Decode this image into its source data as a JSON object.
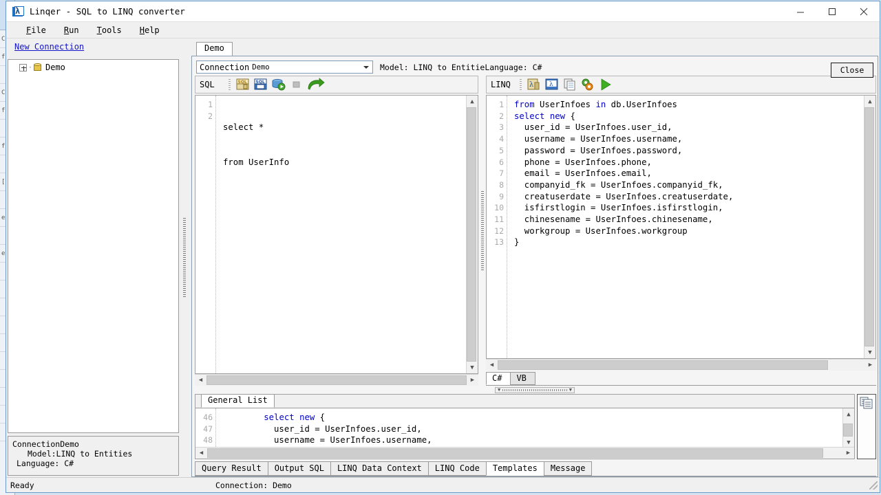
{
  "window": {
    "title": "Linqer - SQL to LINQ converter",
    "app_icon": "linqer-lambda-icon",
    "minimize": "minimize-icon",
    "maximize": "maximize-icon",
    "close": "close-icon"
  },
  "menu": {
    "items": [
      {
        "label": "File",
        "accel": "F"
      },
      {
        "label": "Run",
        "accel": "R"
      },
      {
        "label": "Tools",
        "accel": "T"
      },
      {
        "label": "Help",
        "accel": "H"
      }
    ]
  },
  "sidebar": {
    "new_connection": "New Connection",
    "tree": [
      {
        "label": "Demo",
        "icon": "database-icon",
        "expanded": false
      }
    ],
    "properties": {
      "line1": "ConnectionDemo",
      "line2": "Model:LINQ to Entities",
      "line3": "Language: C#"
    }
  },
  "document": {
    "tabs": [
      {
        "label": "Demo",
        "selected": true
      }
    ],
    "connection": {
      "label": "Connection",
      "value": "Demo"
    },
    "model_label": "Model: LINQ to Entitie",
    "language_label": "Language: C#",
    "close_button": "Close"
  },
  "sql_editor": {
    "toolbar_label": "SQL",
    "icons": [
      "open-sql-file-icon",
      "save-sql-file-icon",
      "execute-database-icon",
      "stop-icon",
      "convert-to-linq-icon"
    ],
    "line_numbers": [
      "1",
      "2"
    ],
    "lines": [
      "select *",
      "from UserInfo"
    ]
  },
  "linq_editor": {
    "toolbar_label": "LINQ",
    "icons": [
      "open-linq-file-icon",
      "save-linq-file-icon",
      "copy-icon",
      "options-gear-icon",
      "run-icon"
    ],
    "line_numbers": [
      "1",
      "2",
      "3",
      "4",
      "5",
      "6",
      "7",
      "8",
      "9",
      "10",
      "11",
      "12",
      "13"
    ],
    "lines": [
      [
        {
          "t": "from",
          "k": true
        },
        {
          "t": " UserInfoes ",
          "k": false
        },
        {
          "t": "in",
          "k": true
        },
        {
          "t": " db.UserInfoes",
          "k": false
        }
      ],
      [
        {
          "t": "select",
          "k": true
        },
        {
          "t": " ",
          "k": false
        },
        {
          "t": "new",
          "k": true
        },
        {
          "t": " {",
          "k": false
        }
      ],
      [
        {
          "t": "  user_id = UserInfoes.user_id,",
          "k": false
        }
      ],
      [
        {
          "t": "  username = UserInfoes.username,",
          "k": false
        }
      ],
      [
        {
          "t": "  password = UserInfoes.password,",
          "k": false
        }
      ],
      [
        {
          "t": "  phone = UserInfoes.phone,",
          "k": false
        }
      ],
      [
        {
          "t": "  email = UserInfoes.email,",
          "k": false
        }
      ],
      [
        {
          "t": "  companyid_fk = UserInfoes.companyid_fk,",
          "k": false
        }
      ],
      [
        {
          "t": "  creatuserdate = UserInfoes.creatuserdate,",
          "k": false
        }
      ],
      [
        {
          "t": "  isfirstlogin = UserInfoes.isfirstlogin,",
          "k": false
        }
      ],
      [
        {
          "t": "  chinesename = UserInfoes.chinesename,",
          "k": false
        }
      ],
      [
        {
          "t": "  workgroup = UserInfoes.workgroup",
          "k": false
        }
      ],
      [
        {
          "t": "}",
          "k": false
        }
      ]
    ],
    "language_tabs": [
      {
        "label": "C#",
        "selected": true
      },
      {
        "label": "VB",
        "selected": false
      }
    ]
  },
  "templates_panel": {
    "tabs": [
      {
        "label": "General List",
        "selected": true
      }
    ],
    "line_numbers": [
      "46",
      "47",
      "48"
    ],
    "lines": [
      [
        {
          "t": "        ",
          "k": false
        },
        {
          "t": "select",
          "k": true
        },
        {
          "t": " ",
          "k": false
        },
        {
          "t": "new",
          "k": true
        },
        {
          "t": " {",
          "k": false
        }
      ],
      [
        {
          "t": "          user_id = UserInfoes.user_id,",
          "k": false
        }
      ],
      [
        {
          "t": "          username = UserInfoes.username,",
          "k": false
        }
      ]
    ],
    "side_icon": "copy-template-icon"
  },
  "result_tabs": [
    {
      "label": "Query Result",
      "selected": false
    },
    {
      "label": "Output SQL",
      "selected": false
    },
    {
      "label": "LINQ Data Context",
      "selected": false
    },
    {
      "label": "LINQ Code",
      "selected": false
    },
    {
      "label": "Templates",
      "selected": true
    },
    {
      "label": "Message",
      "selected": false
    }
  ],
  "statusbar": {
    "left": "Ready",
    "right": "Connection: Demo"
  },
  "background_window": {
    "fragments": [
      "C",
      "fi",
      "C",
      "fi",
      "fi",
      "[]",
      "es",
      "e"
    ]
  },
  "colors": {
    "keyword": "#0000c8",
    "link": "#1414c8",
    "window_border": "#6b9ac8",
    "desktop": "#d6e3f0"
  }
}
